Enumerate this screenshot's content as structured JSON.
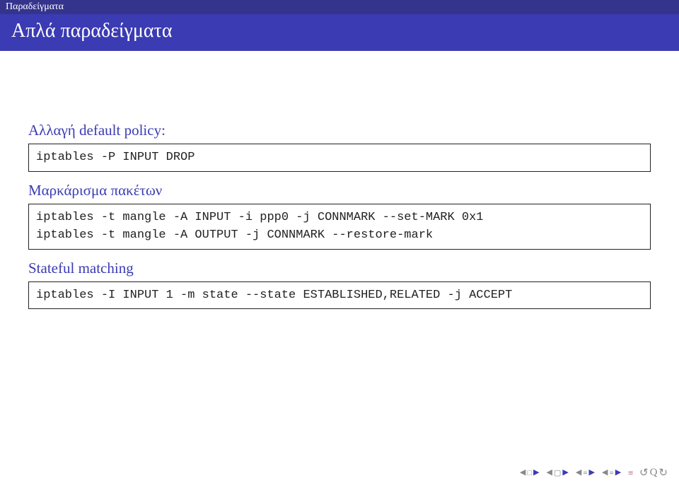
{
  "header": {
    "section_label": "Παραδείγματα",
    "title": "Απλά παραδείγματα"
  },
  "blocks": {
    "policy": {
      "label": "Αλλαγή default policy:",
      "code": "iptables -P INPUT DROP"
    },
    "mark": {
      "label": "Μαρκάρισμα πακέτων",
      "code": "iptables -t mangle -A INPUT -i ppp0 -j CONNMARK --set-MARK 0x1\niptables -t mangle -A OUTPUT -j CONNMARK --restore-mark"
    },
    "stateful": {
      "label": "Stateful matching",
      "code": "iptables -I INPUT 1 -m state --state ESTABLISHED,RELATED -j ACCEPT"
    }
  }
}
